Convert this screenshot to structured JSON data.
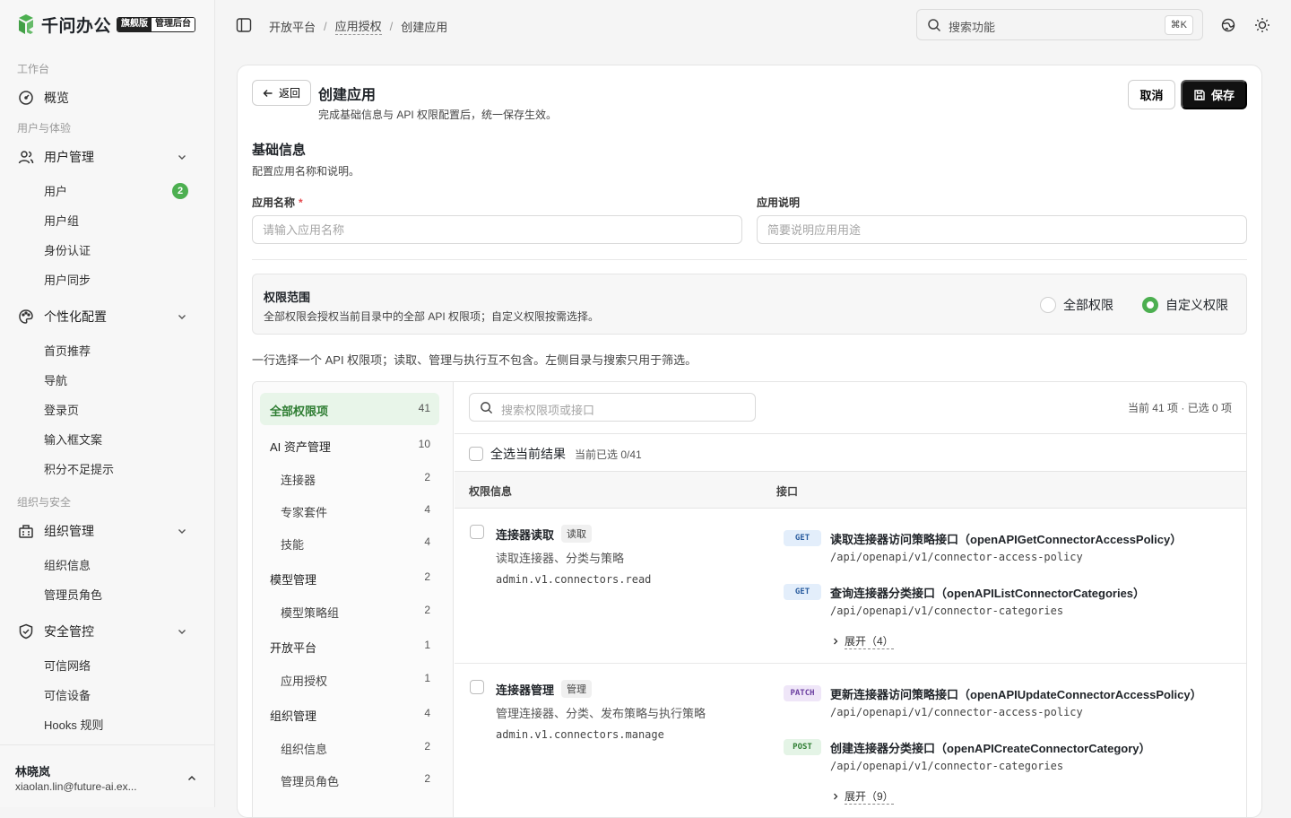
{
  "brand": {
    "name": "千问办公",
    "badge_primary": "旗舰版",
    "badge_secondary": "管理后台",
    "accent": "#4caf50"
  },
  "sidebar": {
    "groups": [
      {
        "title": "工作台"
      },
      {
        "title": "用户与体验"
      },
      {
        "title": "组织与安全"
      }
    ],
    "items": {
      "overview": "概览",
      "user_mgmt": "用户管理",
      "users": "用户",
      "users_badge": "2",
      "user_groups": "用户组",
      "identity": "身份认证",
      "user_sync": "用户同步",
      "personalize": "个性化配置",
      "home_reco": "首页推荐",
      "nav": "导航",
      "login": "登录页",
      "input_copy": "输入框文案",
      "points_tip": "积分不足提示",
      "org_mgmt": "组织管理",
      "org_info": "组织信息",
      "admin_roles": "管理员角色",
      "security": "安全管控",
      "trusted_net": "可信网络",
      "trusted_dev": "可信设备",
      "hooks": "Hooks 规则"
    },
    "user": {
      "name": "林晓岚",
      "email": "xiaolan.lin@future-ai.ex..."
    }
  },
  "topbar": {
    "breadcrumb": [
      "开放平台",
      "应用授权",
      "创建应用"
    ],
    "search_placeholder": "搜索功能",
    "shortcut": "⌘K"
  },
  "page": {
    "back_label": "返回",
    "title": "创建应用",
    "subtitle": "完成基础信息与 API 权限配置后，统一保存生效。",
    "cancel_label": "取消",
    "save_label": "保存"
  },
  "basic": {
    "title": "基础信息",
    "subtitle": "配置应用名称和说明。",
    "name_label": "应用名称",
    "name_required": "*",
    "name_placeholder": "请输入应用名称",
    "desc_label": "应用说明",
    "desc_placeholder": "简要说明应用用途"
  },
  "scope": {
    "title": "权限范围",
    "subtitle": "全部权限会授权当前目录中的全部 API 权限项；自定义权限按需选择。",
    "options": [
      {
        "label": "全部权限",
        "selected": false
      },
      {
        "label": "自定义权限",
        "selected": true
      }
    ]
  },
  "hint": "一行选择一个 API 权限项；读取、管理与执行互不包含。左侧目录与搜索只用于筛选。",
  "categories": [
    {
      "label": "全部权限项",
      "count": "41"
    },
    {
      "label": "AI 资产管理",
      "count": "10"
    },
    {
      "label": "连接器",
      "count": "2"
    },
    {
      "label": "专家套件",
      "count": "4"
    },
    {
      "label": "技能",
      "count": "4"
    },
    {
      "label": "模型管理",
      "count": "2"
    },
    {
      "label": "模型策略组",
      "count": "2"
    },
    {
      "label": "开放平台",
      "count": "1"
    },
    {
      "label": "应用授权",
      "count": "1"
    },
    {
      "label": "组织管理",
      "count": "4"
    },
    {
      "label": "组织信息",
      "count": "2"
    },
    {
      "label": "管理员角色",
      "count": "2"
    }
  ],
  "perm_panel": {
    "search_placeholder": "搜索权限项或接口",
    "stats": "当前 41 项 · 已选 0 项",
    "select_all_label": "全选当前结果",
    "select_all_count": "当前已选 0/41",
    "col_info": "权限信息",
    "col_api": "接口"
  },
  "permissions": [
    {
      "name": "连接器读取",
      "tag": "读取",
      "desc": "读取连接器、分类与策略",
      "code": "admin.v1.connectors.read",
      "endpoints": [
        {
          "method": "GET",
          "title": "读取连接器访问策略接口（openAPIGetConnectorAccessPolicy）",
          "path": "/api/openapi/v1/connector-access-policy"
        },
        {
          "method": "GET",
          "title": "查询连接器分类接口（openAPIListConnectorCategories）",
          "path": "/api/openapi/v1/connector-categories"
        }
      ],
      "expand": "展开（4）"
    },
    {
      "name": "连接器管理",
      "tag": "管理",
      "desc": "管理连接器、分类、发布策略与执行策略",
      "code": "admin.v1.connectors.manage",
      "endpoints": [
        {
          "method": "PATCH",
          "title": "更新连接器访问策略接口（openAPIUpdateConnectorAccessPolicy）",
          "path": "/api/openapi/v1/connector-access-policy"
        },
        {
          "method": "POST",
          "title": "创建连接器分类接口（openAPICreateConnectorCategory）",
          "path": "/api/openapi/v1/connector-categories"
        }
      ],
      "expand": "展开（9）"
    }
  ]
}
